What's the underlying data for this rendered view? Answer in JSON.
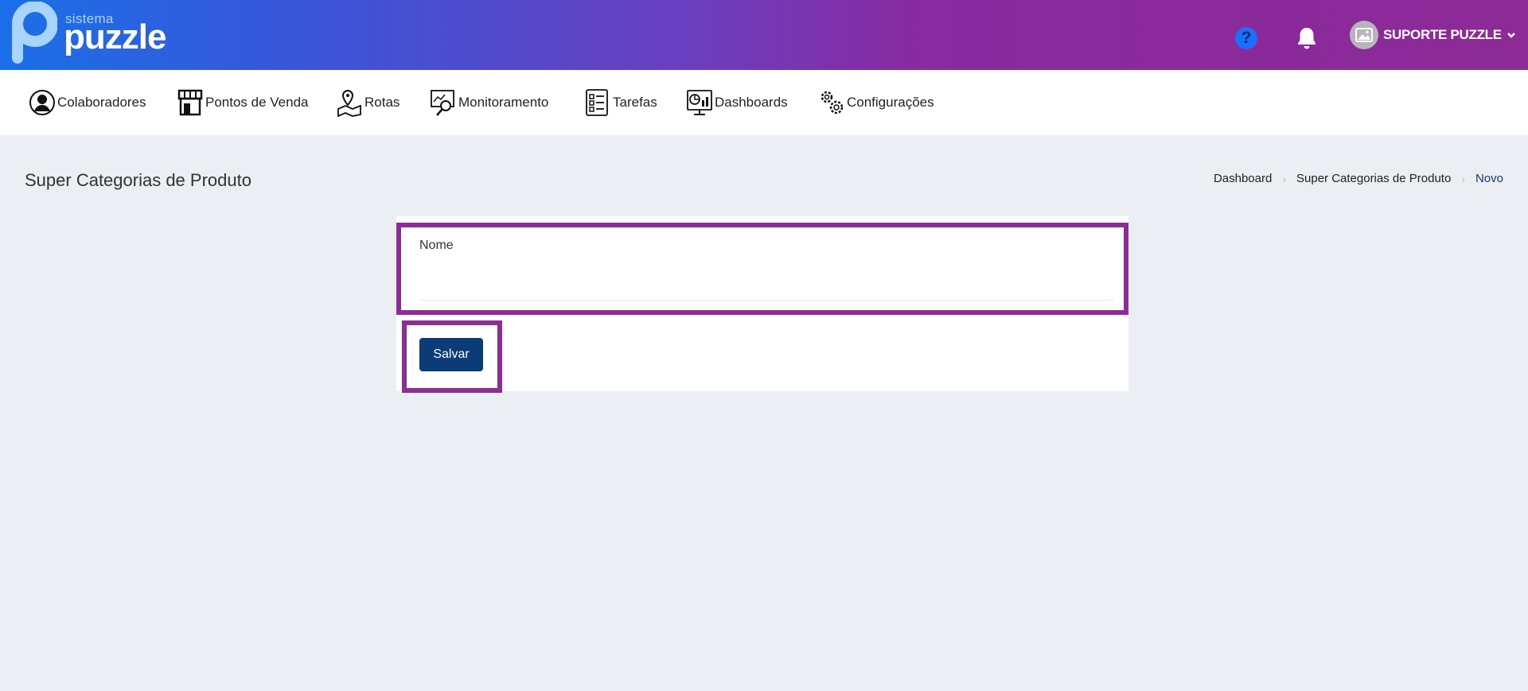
{
  "header": {
    "logo_small": "sistema",
    "logo_big": "puzzle",
    "help_icon": "question-circle-icon",
    "bell_icon": "bell-icon",
    "user_name": "SUPORTE PUZZLE",
    "colors": {
      "gradient_start": "#1a6fe8",
      "gradient_end": "#8c2a96"
    }
  },
  "nav": {
    "items": [
      {
        "label": "Colaboradores",
        "icon": "user-circle-icon"
      },
      {
        "label": "Pontos de Venda",
        "icon": "store-icon"
      },
      {
        "label": "Rotas",
        "icon": "map-pin-icon"
      },
      {
        "label": "Monitoramento",
        "icon": "monitor-search-icon"
      },
      {
        "label": "Tarefas",
        "icon": "checklist-icon"
      },
      {
        "label": "Dashboards",
        "icon": "dashboard-monitor-icon"
      },
      {
        "label": "Configurações",
        "icon": "gears-icon"
      }
    ]
  },
  "page": {
    "title": "Super Categorias de Produto",
    "breadcrumb": [
      "Dashboard",
      "Super Categorias de Produto",
      "Novo"
    ]
  },
  "form": {
    "name_label": "Nome",
    "name_value": "",
    "save_label": "Salvar",
    "highlight_color": "#8b2d94",
    "button_color": "#0b3c78"
  }
}
